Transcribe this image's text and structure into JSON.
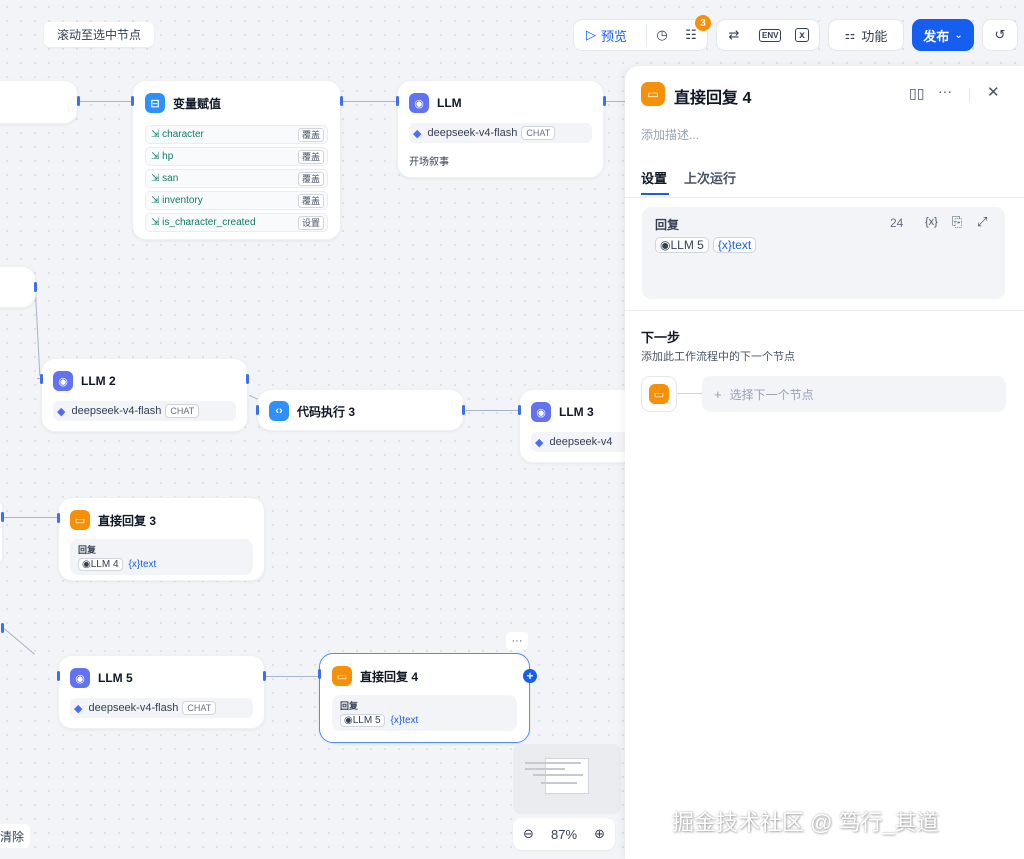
{
  "top_left": {
    "scroll_button": "滚动至选中节点"
  },
  "toolbar": {
    "preview_label": "预览",
    "checklist_count": "3",
    "features_label": "功能",
    "publish_label": "发布",
    "env_label": "ENV"
  },
  "nodes": {
    "assign": {
      "title": "变量赋值",
      "vars": [
        {
          "name": "character",
          "op": "覆盖"
        },
        {
          "name": "hp",
          "op": "覆盖"
        },
        {
          "name": "san",
          "op": "覆盖"
        },
        {
          "name": "inventory",
          "op": "覆盖"
        },
        {
          "name": "is_character_created",
          "op": "设置"
        }
      ]
    },
    "llm": {
      "title": "LLM",
      "model": "deepseek-v4-flash",
      "tag": "CHAT",
      "desc": "开场叙事"
    },
    "llm2": {
      "title": "LLM 2",
      "model": "deepseek-v4-flash",
      "tag": "CHAT"
    },
    "code3": {
      "title": "代码执行 3"
    },
    "llm3": {
      "title": "LLM 3",
      "model": "deepseek-v4"
    },
    "reply3": {
      "title": "直接回复 3",
      "label": "回复",
      "ref_node": "LLM 4",
      "ref_var": "text"
    },
    "llm5": {
      "title": "LLM 5",
      "model": "deepseek-v4-flash",
      "tag": "CHAT"
    },
    "reply4": {
      "title": "直接回复 4",
      "label": "回复",
      "ref_node": "LLM 5",
      "ref_var": "text"
    }
  },
  "bottom": {
    "clear_label": "清除",
    "zoom": "87%"
  },
  "watermark": "掘金技术社区 @ 笃行_其道",
  "panel": {
    "title": "直接回复 4",
    "desc_placeholder": "添加描述...",
    "tabs": [
      "设置",
      "上次运行"
    ],
    "reply": {
      "label": "回复",
      "count": "24",
      "var_btn": "{x}",
      "ref_node": "LLM 5",
      "ref_var": "text"
    },
    "next": {
      "title": "下一步",
      "subtitle": "添加此工作流程中的下一个节点",
      "select_placeholder": "选择下一个节点"
    }
  },
  "colors": {
    "primary": "#155eef",
    "llm_badge": "#6172f3",
    "code_badge": "#2e90fa",
    "reply_badge": "#f79009"
  }
}
